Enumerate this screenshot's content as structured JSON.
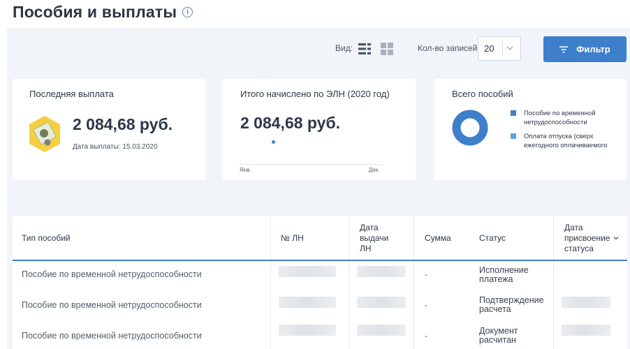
{
  "page": {
    "title": "Пособия и выплаты"
  },
  "toolbar": {
    "view_label": "Вид:",
    "records_label": "Кол-во записей",
    "records_value": "20",
    "filter_label": "Фильтр"
  },
  "cards": {
    "last_payment": {
      "title": "Последняя выплата",
      "amount": "2 084,68 руб.",
      "date_label": "Дата выплаты: 15.03.2020"
    },
    "total": {
      "title": "Итого начислено по ЭЛН (2020 год)",
      "amount": "2 084,68 руб.",
      "axis_start": "Янв.",
      "axis_end": "Дек."
    },
    "benefits": {
      "title": "Всего пособий",
      "legend": [
        {
          "label": "Пособие по временной нетрудоспособности",
          "color": "#3e7fcb"
        },
        {
          "label": "Оплата отпуска (сверх ежегодного оплачиваемого",
          "color": "#56a6e0"
        }
      ]
    }
  },
  "table": {
    "headers": {
      "type": "Тип пособий",
      "ln": "№ ЛН",
      "issue_date": "Дата выдачи ЛН",
      "sum": "Сумма",
      "status": "Статус",
      "status_date": "Дата присвоение статуса"
    },
    "rows": [
      {
        "type": "Пособие по временной нетрудоспособности",
        "sum": "-",
        "status": "Исполнение платежа"
      },
      {
        "type": "Пособие по временной нетрудоспособности",
        "sum": "-",
        "status": "Подтверждение расчета"
      },
      {
        "type": "Пособие по временной нетрудоспособности",
        "sum": "-",
        "status": "Документ расчитан"
      }
    ]
  },
  "colors": {
    "accent": "#3e7fcb",
    "panel_bg": "#f1f5fa"
  }
}
